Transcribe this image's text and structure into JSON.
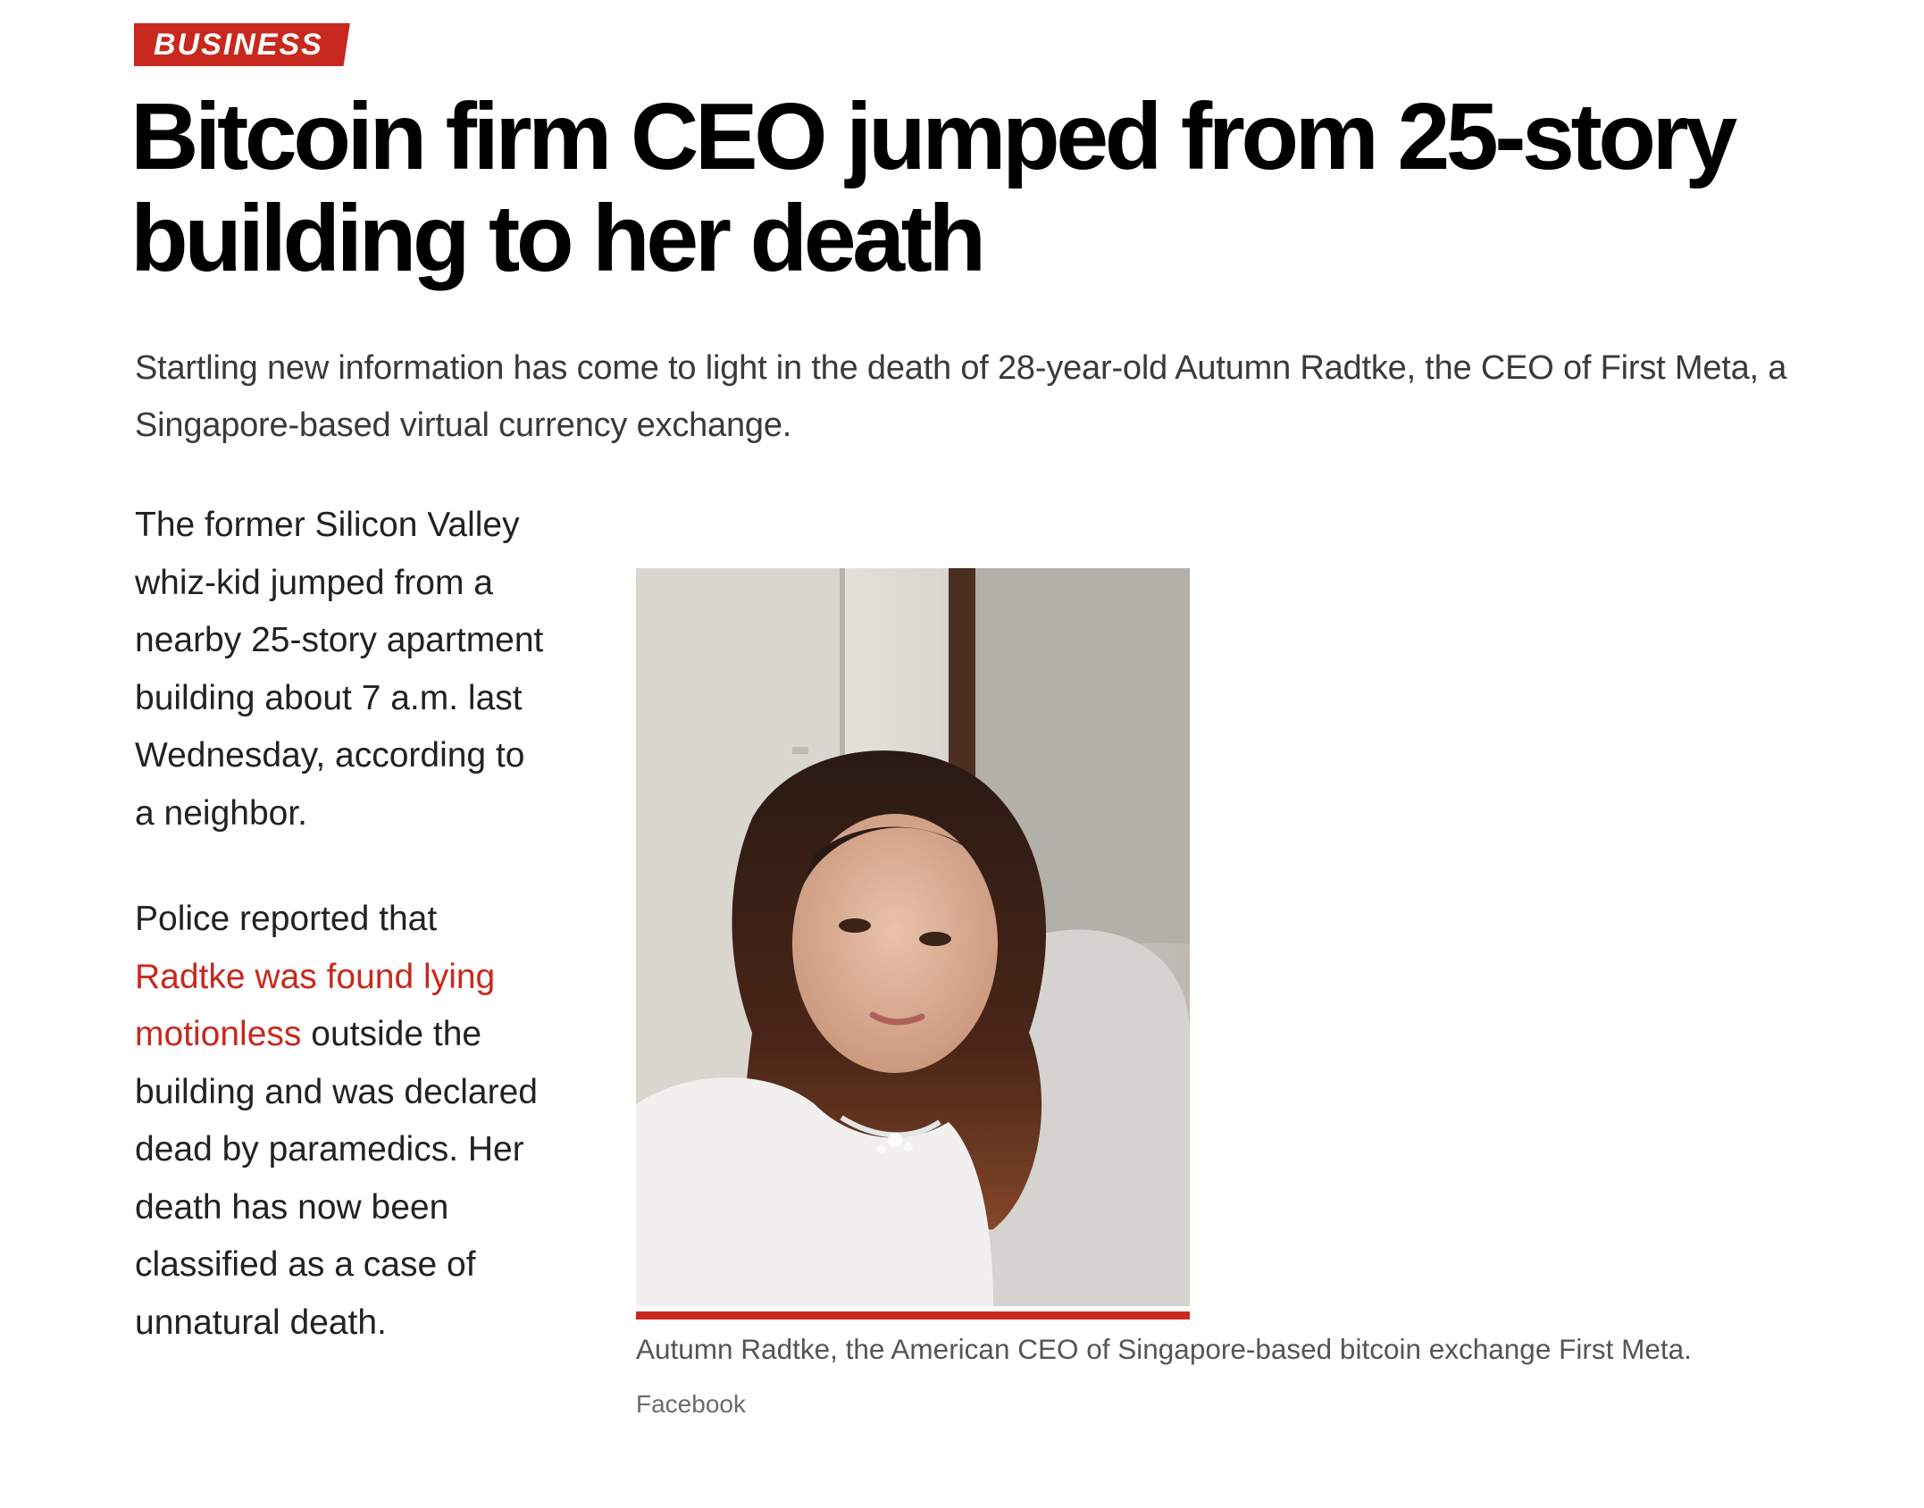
{
  "section": {
    "label": "BUSINESS"
  },
  "article": {
    "headline": "Bitcoin firm CEO jumped from 25-story building to her death",
    "dek": "Startling new information has come to light in the death of 28-year-old Autumn Radtke, the CEO of First Meta, a Singapore-based virtual currency exchange.",
    "paragraph_1": "The former Silicon Valley whiz-kid jumped from a nearby 25-story apartment building about 7 a.m. last Wednesday, according to a neighbor.",
    "paragraph_2_lead": "Police reported that ",
    "paragraph_2_link": "Radtke was found lying motionless",
    "paragraph_2_rest": " outside the building and was declared dead by paramedics. Her death has now been classified as a case of unnatural death."
  },
  "figure": {
    "caption": "Autumn Radtke, the American CEO of Singapore-based bitcoin exchange First Meta.",
    "credit": "Facebook"
  },
  "colors": {
    "accent": "#c8281d",
    "headline": "#000000",
    "body_text": "#222222",
    "caption_text": "#555555"
  }
}
